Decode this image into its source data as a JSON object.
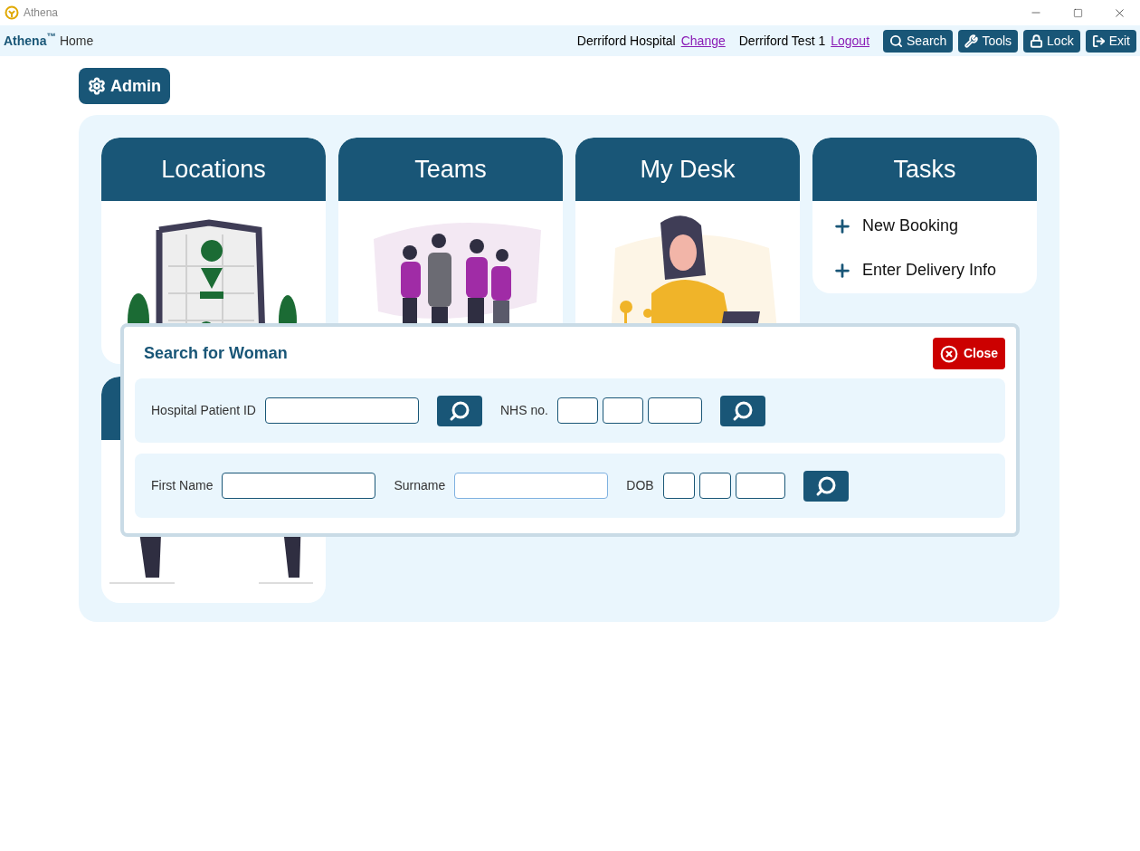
{
  "window": {
    "title": "Athena"
  },
  "header": {
    "brand": "Athena$^{™}$",
    "page": "Home",
    "hospital": "Derriford Hospital",
    "change_link": "Change",
    "user": "Derriford Test 1",
    "logout_link": "Logout",
    "buttons": [
      {
        "kind": "search",
        "label": "Search"
      },
      {
        "kind": "tools",
        "label": "Tools"
      },
      {
        "kind": "lock",
        "label": "Lock"
      },
      {
        "kind": "exit",
        "label": "Exit"
      }
    ]
  },
  "admin_button": {
    "label": "Admin"
  },
  "cards": [
    {
      "kind": "map",
      "title": "Locations"
    },
    {
      "kind": "team",
      "title": "Teams"
    },
    {
      "kind": "desk",
      "title": "My Desk"
    },
    {
      "kind": "tasks",
      "title": "Tasks",
      "items": [
        "New Booking",
        "Enter Delivery Info"
      ]
    },
    {
      "kind": "legs"
    }
  ],
  "dialog": {
    "title": "Search for Woman",
    "close_label": "Close",
    "rows": [
      {
        "groups": [
          {
            "kind": "text",
            "label": "Hospital Patient ID",
            "focused": false
          },
          {
            "kind": "search"
          },
          {
            "kind": "nhs",
            "label": "NHS no.",
            "focused": false
          },
          {
            "kind": "search"
          }
        ]
      },
      {
        "groups": [
          {
            "kind": "text",
            "label": "First Name",
            "focused": false
          },
          {
            "kind": "text",
            "label": "Surname",
            "focused": true
          },
          {
            "kind": "date",
            "label": "DOB",
            "focused": false
          },
          {
            "kind": "search"
          }
        ]
      }
    ]
  }
}
